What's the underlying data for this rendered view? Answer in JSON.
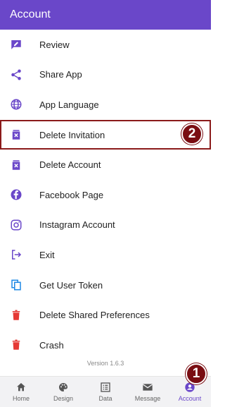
{
  "header": {
    "title": "Account"
  },
  "menu": [
    {
      "label": "Review",
      "icon": "review-icon",
      "color": "#6a47c9"
    },
    {
      "label": "Share App",
      "icon": "share-icon",
      "color": "#6a47c9"
    },
    {
      "label": "App Language",
      "icon": "globe-icon",
      "color": "#6a47c9"
    },
    {
      "label": "Delete Invitation",
      "icon": "delete-box-icon",
      "color": "#6a47c9"
    },
    {
      "label": "Delete Account",
      "icon": "delete-box-icon",
      "color": "#6a47c9"
    },
    {
      "label": "Facebook Page",
      "icon": "facebook-icon",
      "color": "#6a47c9"
    },
    {
      "label": "Instagram Account",
      "icon": "instagram-icon",
      "color": "#6a47c9"
    },
    {
      "label": "Exit",
      "icon": "exit-icon",
      "color": "#6a47c9"
    },
    {
      "label": "Get User Token",
      "icon": "copy-icon",
      "color": "#1e88e5"
    },
    {
      "label": "Delete Shared Preferences",
      "icon": "trash-icon",
      "color": "#e53935"
    },
    {
      "label": "Crash",
      "icon": "trash-icon",
      "color": "#e53935"
    }
  ],
  "version": "Version 1.6.3",
  "badges": {
    "first": "1",
    "second": "2"
  },
  "bottom_nav": [
    {
      "label": "Home",
      "icon": "home-icon"
    },
    {
      "label": "Design",
      "icon": "palette-icon"
    },
    {
      "label": "Data",
      "icon": "list-icon"
    },
    {
      "label": "Message",
      "icon": "mail-icon"
    },
    {
      "label": "Account",
      "icon": "account-icon",
      "active": true
    }
  ],
  "colors": {
    "accent": "#6a47c9",
    "badge": "#7a0d12"
  }
}
